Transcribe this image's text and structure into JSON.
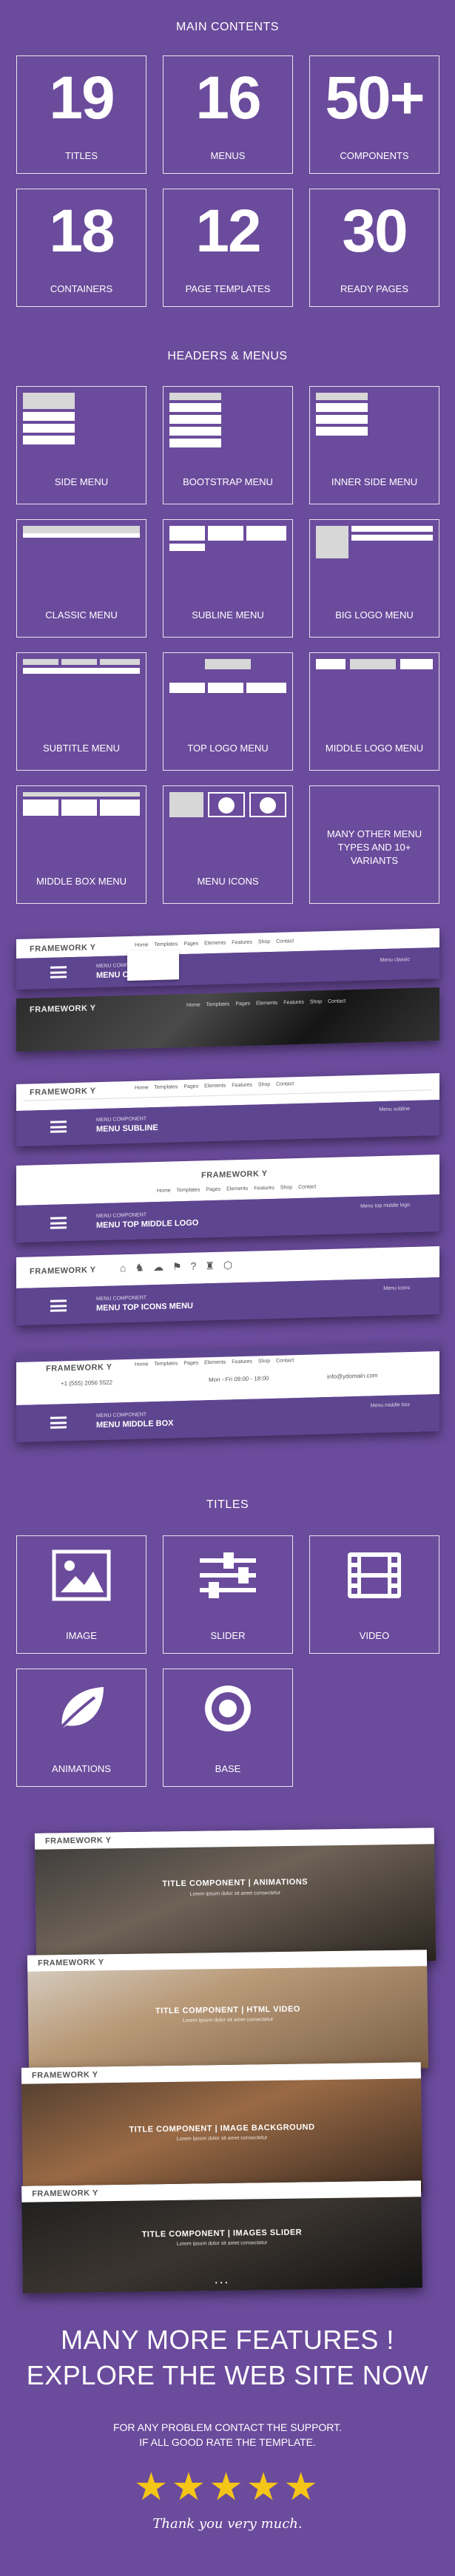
{
  "sections": {
    "main_contents": "MAIN CONTENTS",
    "headers_menus": "HEADERS & MENUS",
    "titles": "TITLES"
  },
  "stats": [
    {
      "num": "19",
      "label": "TITLES"
    },
    {
      "num": "16",
      "label": "MENUS"
    },
    {
      "num": "50+",
      "label": "COMPONENTS"
    },
    {
      "num": "18",
      "label": "CONTAINERS"
    },
    {
      "num": "12",
      "label": "PAGE TEMPLATES"
    },
    {
      "num": "30",
      "label": "READY PAGES"
    }
  ],
  "menus": [
    "SIDE MENU",
    "BOOTSTRAP MENU",
    "INNER SIDE MENU",
    "CLASSIC MENU",
    "SUBLINE MENU",
    "BIG LOGO MENU",
    "SUBTITLE MENU",
    "TOP LOGO MENU",
    "MIDDLE LOGO MENU",
    "MIDDLE BOX MENU",
    "MENU ICONS",
    "MANY OTHER MENU TYPES AND 10+ VARIANTS"
  ],
  "previews": {
    "logo": "FRAMEWORK Y",
    "menu_component": "MENU COMPONENT",
    "home_crumb": "Home",
    "p1": {
      "title": "MENU CLASSIC",
      "crumb": "Menu classic"
    },
    "p3": {
      "title": "MENU SUBLINE",
      "crumb": "Menu subline"
    },
    "p4": {
      "title": "MENU TOP MIDDLE LOGO",
      "crumb": "Menu top middle logo"
    },
    "p5": {
      "title": "MENU TOP ICONS MENU",
      "crumb": "Menu icons"
    },
    "p6": {
      "title": "MENU MIDDLE BOX",
      "crumb": "Menu middle box"
    },
    "nav_links": "Home  Templates  Pages  Elements  Features  Shop  Contact",
    "phone": "+1 (555) 2056 5522",
    "hours": "Mon - Fri 09:00 - 18:00",
    "email": "info@ydomain.com"
  },
  "titles": [
    {
      "label": "IMAGE",
      "icon": "image-icon"
    },
    {
      "label": "SLIDER",
      "icon": "sliders-icon"
    },
    {
      "label": "VIDEO",
      "icon": "film-icon"
    },
    {
      "label": "ANIMATIONS",
      "icon": "leaf-icon"
    },
    {
      "label": "BASE",
      "icon": "target-icon"
    }
  ],
  "title_shots": [
    {
      "caption": "TITLE COMPONENT | ANIMATIONS",
      "sub": "Lorem ipsum dolor sit amet consectetur"
    },
    {
      "caption": "TITLE COMPONENT | HTML VIDEO",
      "sub": "Lorem ipsum dolor sit amet consectetur"
    },
    {
      "caption": "TITLE COMPONENT | IMAGE BACKGROUND",
      "sub": "Lorem ipsum dolor sit amet consectetur"
    },
    {
      "caption": "TITLE COMPONENT | IMAGES SLIDER",
      "sub": "Lorem ipsum dolor sit amet consectetur"
    }
  ],
  "cta_line1": "MANY MORE FEATURES !",
  "cta_line2": "EXPLORE THE WEB SITE NOW",
  "support_line1": "FOR ANY PROBLEM CONTACT THE SUPPORT.",
  "support_line2": "IF ALL GOOD RATE THE TEMPLATE.",
  "stars": "★★★★★",
  "thanks": "Thank you very much.",
  "colors": {
    "background": "#6b4b9c",
    "band": "#5e4590",
    "star": "#f5c518"
  }
}
